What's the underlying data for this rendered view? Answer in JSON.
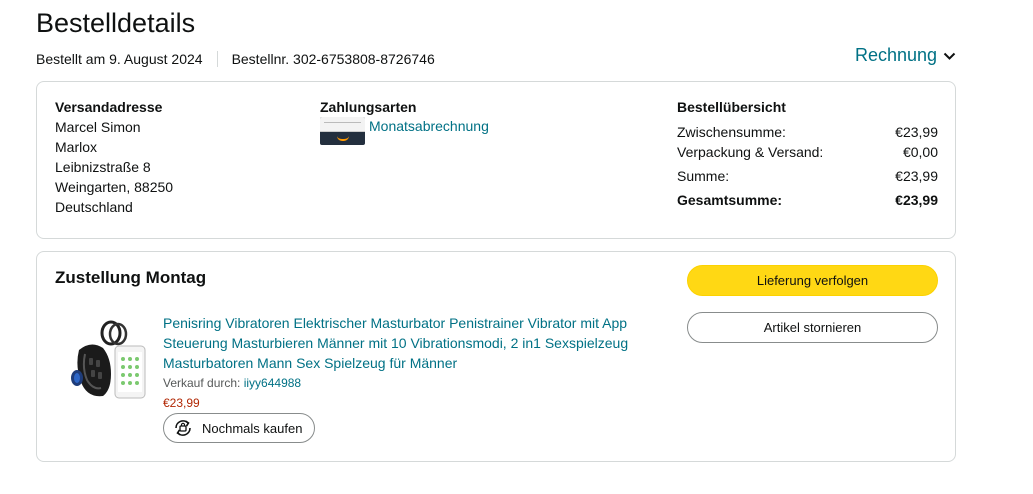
{
  "page": {
    "title": "Bestelldetails",
    "ordered_on": "Bestellt am 9. August 2024",
    "order_number": "Bestellnr. 302-6753808-8726746",
    "invoice_label": "Rechnung"
  },
  "shipping": {
    "heading": "Versandadresse",
    "lines": [
      "Marcel Simon",
      "Marlox",
      "Leibnizstraße 8",
      "Weingarten, 88250",
      "Deutschland"
    ]
  },
  "payment": {
    "heading": "Zahlungsarten",
    "method": "Monatsabrechnung"
  },
  "summary": {
    "heading": "Bestellübersicht",
    "subtotal_label": "Zwischensumme:",
    "subtotal_value": "€23,99",
    "shipping_label": "Verpackung & Versand:",
    "shipping_value": "€0,00",
    "sum_label": "Summe:",
    "sum_value": "€23,99",
    "total_label": "Gesamtsumme:",
    "total_value": "€23,99"
  },
  "delivery": {
    "heading": "Zustellung Montag",
    "track_label": "Lieferung verfolgen",
    "cancel_label": "Artikel stornieren"
  },
  "product": {
    "title": "Penisring Vibratoren Elektrischer Masturbator Penistrainer Vibrator mit App Steuerung Masturbieren Männer mit 10 Vibrationsmodi, 2 in1 Sexspielzeug Masturbatoren Mann Sex Spielzeug für Männer",
    "seller_prefix": "Verkauf durch: ",
    "seller_name": "iiyy644988",
    "price": "€23,99",
    "rebuy_label": "Nochmals kaufen"
  },
  "colors": {
    "link": "#007185",
    "price": "#b12704",
    "primary_button": "#ffd814"
  }
}
